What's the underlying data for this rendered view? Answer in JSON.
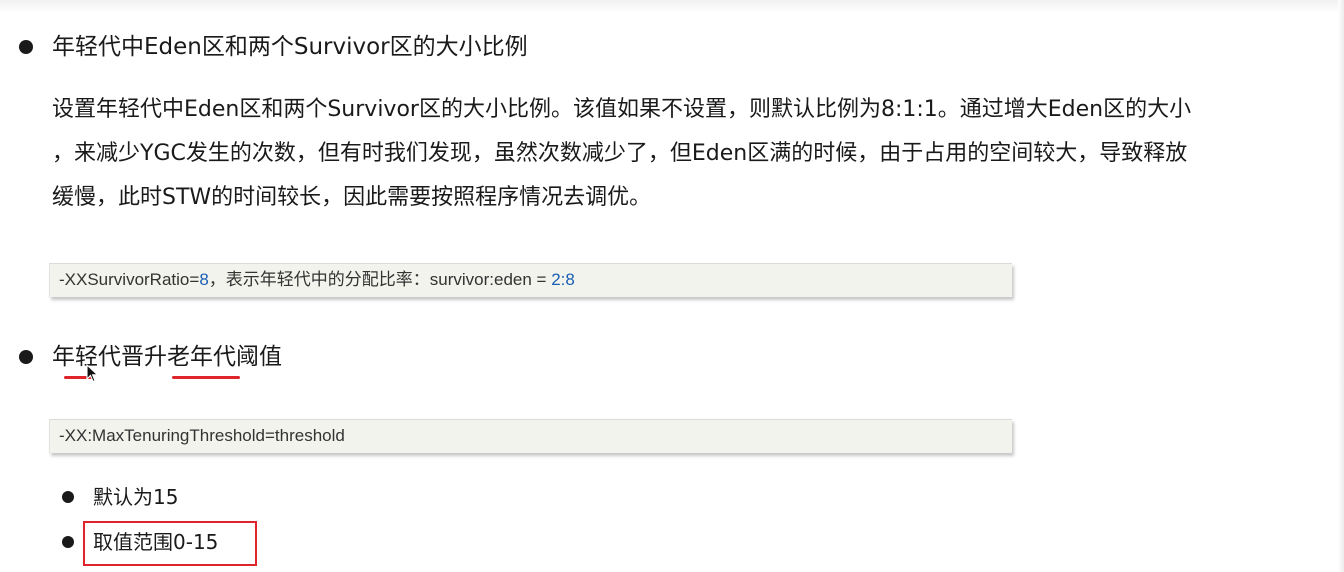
{
  "section1": {
    "heading": "年轻代中Eden区和两个Survivor区的大小比例",
    "paragraph_lines": [
      "设置年轻代中Eden区和两个Survivor区的大小比例。该值如果不设置，则默认比例为8:1:1。通过增大Eden区的大小",
      "，来减少YGC发生的次数，但有时我们发现，虽然次数减少了，但Eden区满的时候，由于占用的空间较大，导致释放",
      "缓慢，此时STW的时间较长，因此需要按照程序情况去调优。"
    ],
    "code": {
      "prefix": "-XXSurvivorRatio=",
      "value": "8",
      "middle": "，表示年轻代中的分配比率：survivor:eden = ",
      "ratio": "2:8"
    }
  },
  "section2": {
    "heading": "年轻代晋升老年代阈值",
    "code": "-XX:MaxTenuringThreshold=threshold",
    "items": [
      "默认为15",
      "取值范围0-15"
    ]
  },
  "colors": {
    "annotation_red": "#e0242b",
    "code_number_blue": "#1a5fb4",
    "code_background": "#f2f3ec"
  }
}
